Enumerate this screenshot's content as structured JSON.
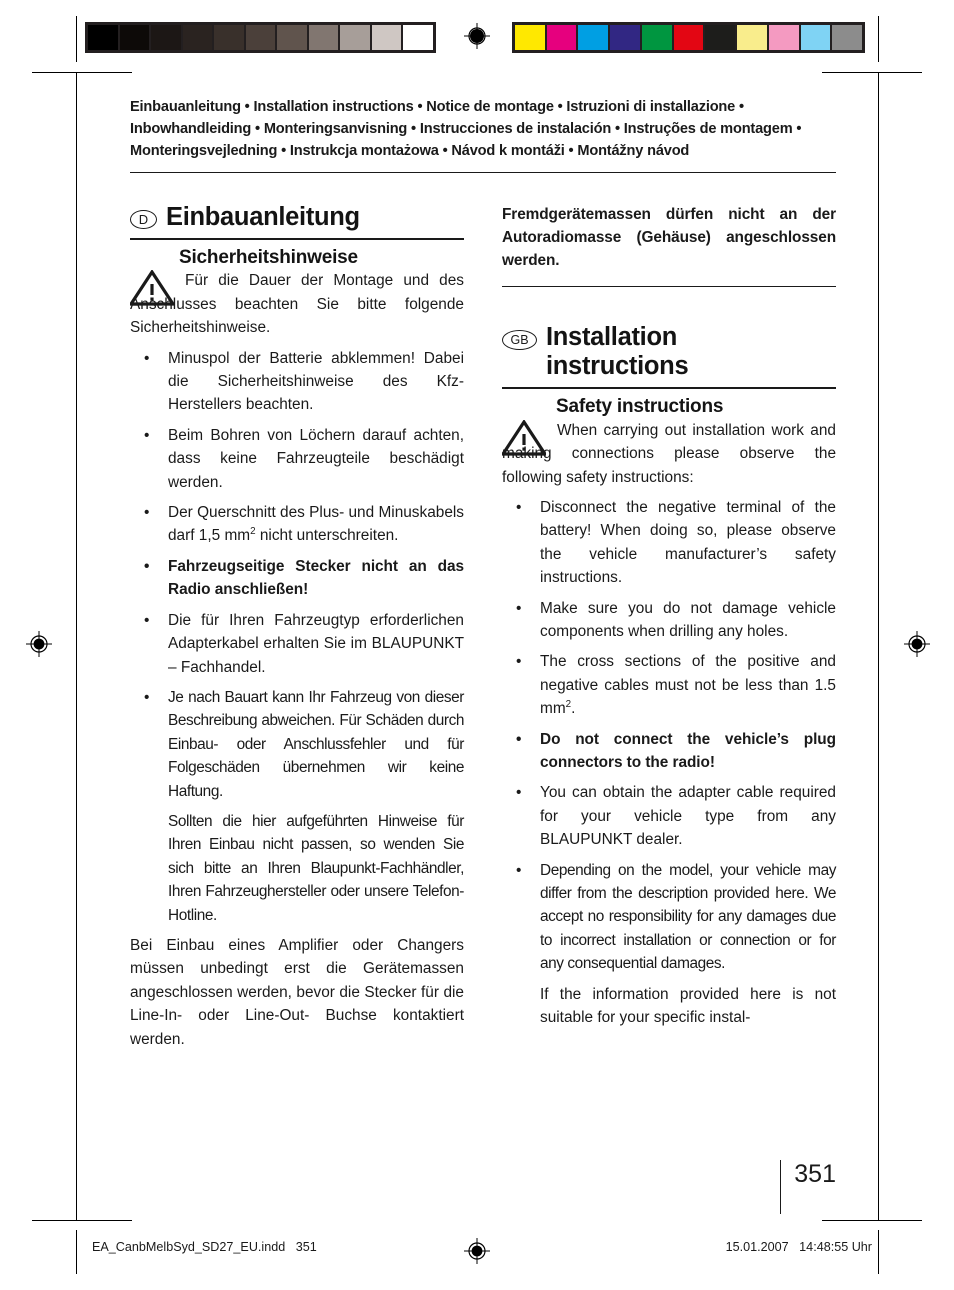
{
  "prepress": {
    "gray_strip": {
      "name": "grayscale-step-wedge",
      "patches": [
        "#000000",
        "#0d0a08",
        "#1c1715",
        "#2a2320",
        "#39302b",
        "#4b403a",
        "#60544d",
        "#817670",
        "#a79e99",
        "#cfc7c3",
        "#ffffff"
      ]
    },
    "color_strip": {
      "name": "process-color-control-strip",
      "patches": [
        "#ffe800",
        "#e6007e",
        "#009fe3",
        "#312783",
        "#009640",
        "#e30613",
        "#1d1d1b",
        "#f9ed8c",
        "#f49ac1",
        "#7fd3f4",
        "#8c8c8c"
      ]
    }
  },
  "banner": {
    "text": "Einbauanleitung • Installation instructions • Notice de montage • Istruzioni di installazione • Inbowhandleiding • Monteringsanvisning • Instrucciones de instalación • Instruções de montagem • Monteringsvejledning • Instrukcja montażowa • Návod k montáži • Montážny návod"
  },
  "left_column": {
    "section": {
      "badge": "D",
      "title": "Einbauanleitung"
    },
    "subhead": "Sicherheitshinweise",
    "intro": "Für die Dauer der Montage und des Anschlusses beachten Sie bitte folgende Sicherheitshinweise.",
    "bullets": [
      {
        "marker": "•",
        "text": "Minuspol der Batterie abklemmen! Dabei die Sicherheitshinweise des Kfz- Herstellers beachten.",
        "bold": false
      },
      {
        "marker": "•",
        "text": "Beim Bohren von Löchern darauf achten, dass keine Fahrzeugteile beschädigt werden.",
        "bold": false
      },
      {
        "marker": "•",
        "text_pre": "Der Querschnitt des Plus- und Minuskabels darf 1,5 mm",
        "sup": "2",
        "text_post": " nicht unterschreiten.",
        "bold": false
      },
      {
        "marker": "•",
        "text": "Fahrzeugseitige Stecker nicht an das Radio anschließen!",
        "bold": true
      },
      {
        "marker": "•",
        "text": "Die für Ihren Fahrzeugtyp erforderlichen Adapterkabel erhalten Sie im BLAUPUNKT – Fachhandel.",
        "bold": false
      },
      {
        "marker": "•",
        "text": "Je nach Bauart kann Ihr Fahrzeug von dieser Beschreibung abweichen. Für Schäden durch Einbau- oder Anschlussfehler und für Folgeschäden übernehmen wir keine Haftung.",
        "bold": false
      }
    ],
    "sub_para": "Sollten die hier aufgeführten Hinweise für Ihren Einbau nicht passen, so wenden Sie sich bitte an Ihren Blaupunkt-Fachhändler, Ihren Fahrzeughersteller oder unsere Telefon-Hotline.",
    "closing": "Bei Einbau eines Amplifier oder Changers müssen unbedingt erst die Gerätemassen angeschlossen werden, bevor die Stecker für die Line-In- oder Line-Out- Buchse kontaktiert werden."
  },
  "right_column": {
    "carryover_bold": "Fremdgerätemassen dürfen nicht an der Autoradiomasse (Gehäuse) angeschlossen werden.",
    "section": {
      "badge": "GB",
      "title_line1": "Installation",
      "title_line2": "instructions"
    },
    "subhead": "Safety instructions",
    "intro": "When carrying out installation work and making connections please observe the following safety instructions:",
    "bullets": [
      {
        "marker": "•",
        "text": "Disconnect the negative terminal of the battery! When doing so, please observe the vehicle manufacturer’s safety instructions.",
        "bold": false
      },
      {
        "marker": "•",
        "text": "Make sure you do not damage vehicle components when drilling any holes.",
        "bold": false
      },
      {
        "marker": "•",
        "text_pre": "The cross sections of the positive and negative cables must not be less than 1.5 mm",
        "sup": "2",
        "text_post": ".",
        "bold": false
      },
      {
        "marker": "•",
        "text": "Do not connect the vehicle’s plug connectors to the radio!",
        "bold": true
      },
      {
        "marker": "•",
        "text": "You can obtain the adapter cable required for your vehicle type from any BLAUPUNKT dealer.",
        "bold": false
      },
      {
        "marker": "•",
        "text": "Depending on the model, your vehicle may differ from the description provided here. We accept no responsibility for any damages due to incorrect installation or connection or for any consequential damages.",
        "bold": false
      }
    ],
    "sub_para": "If the information provided here is not suitable for your specific instal-"
  },
  "folio": {
    "page_number": "351"
  },
  "footer": {
    "file_name": "EA_CanbMelbSyd_SD27_EU.indd   351",
    "timestamp": "15.01.2007   14:48:55 Uhr"
  },
  "icons": {
    "warning_triangle": "warning-triangle-icon",
    "registration_mark": "registration-target-icon"
  }
}
